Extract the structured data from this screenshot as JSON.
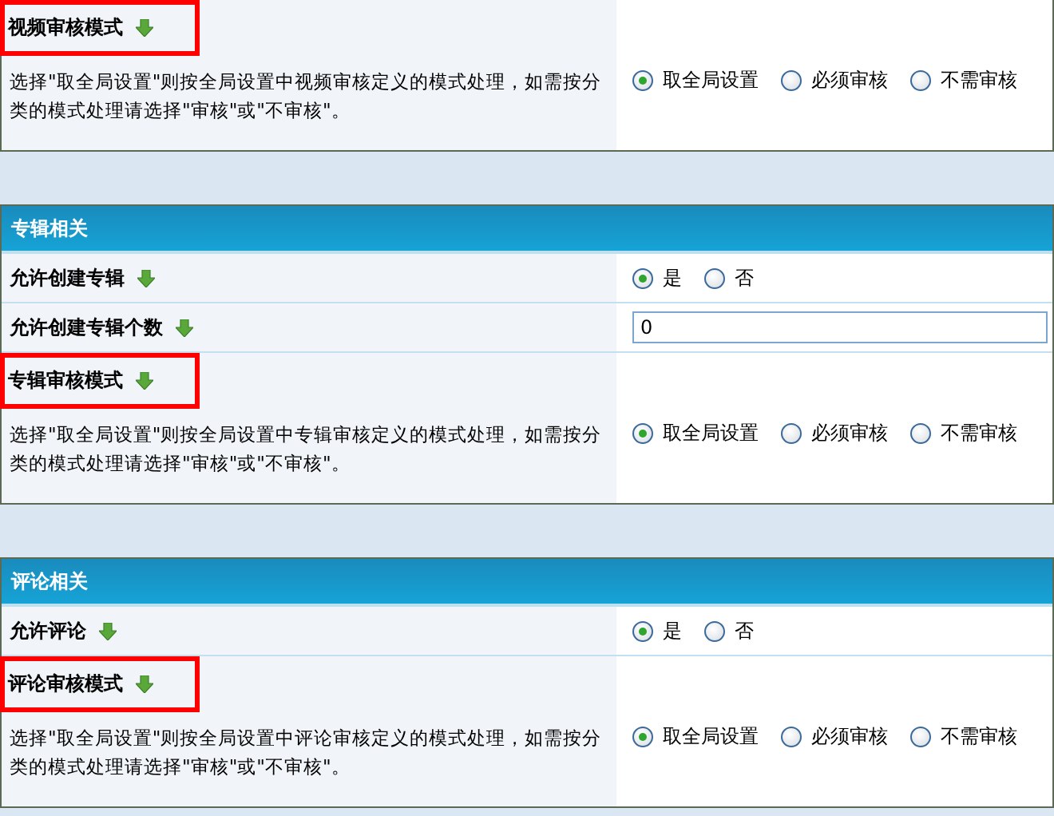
{
  "sections": [
    {
      "rows": [
        {
          "kind": "mode",
          "title": "视频审核模式",
          "highlighted": true,
          "description": "选择\"取全局设置\"则按全局设置中视频审核定义的模式处理，如需按分类的模式处理请选择\"审核\"或\"不审核\"。",
          "options": [
            {
              "label": "取全局设置",
              "selected": true
            },
            {
              "label": "必须审核",
              "selected": false
            },
            {
              "label": "不需审核",
              "selected": false
            }
          ]
        }
      ]
    },
    {
      "header": "专辑相关",
      "rows": [
        {
          "kind": "radio",
          "title": "允许创建专辑",
          "highlighted": false,
          "options": [
            {
              "label": "是",
              "selected": true
            },
            {
              "label": "否",
              "selected": false
            }
          ]
        },
        {
          "kind": "number",
          "title": "允许创建专辑个数",
          "highlighted": false,
          "value": "0"
        },
        {
          "kind": "mode",
          "title": "专辑审核模式",
          "highlighted": true,
          "description": "选择\"取全局设置\"则按全局设置中专辑审核定义的模式处理，如需按分类的模式处理请选择\"审核\"或\"不审核\"。",
          "options": [
            {
              "label": "取全局设置",
              "selected": true
            },
            {
              "label": "必须审核",
              "selected": false
            },
            {
              "label": "不需审核",
              "selected": false
            }
          ]
        }
      ]
    },
    {
      "header": "评论相关",
      "rows": [
        {
          "kind": "radio",
          "title": "允许评论",
          "highlighted": false,
          "options": [
            {
              "label": "是",
              "selected": true
            },
            {
              "label": "否",
              "selected": false
            }
          ]
        },
        {
          "kind": "mode",
          "title": "评论审核模式",
          "highlighted": true,
          "description": "选择\"取全局设置\"则按全局设置中评论审核定义的模式处理，如需按分类的模式处理请选择\"审核\"或\"不审核\"。",
          "options": [
            {
              "label": "取全局设置",
              "selected": true
            },
            {
              "label": "必须审核",
              "selected": false
            },
            {
              "label": "不需审核",
              "selected": false
            }
          ]
        }
      ]
    }
  ]
}
